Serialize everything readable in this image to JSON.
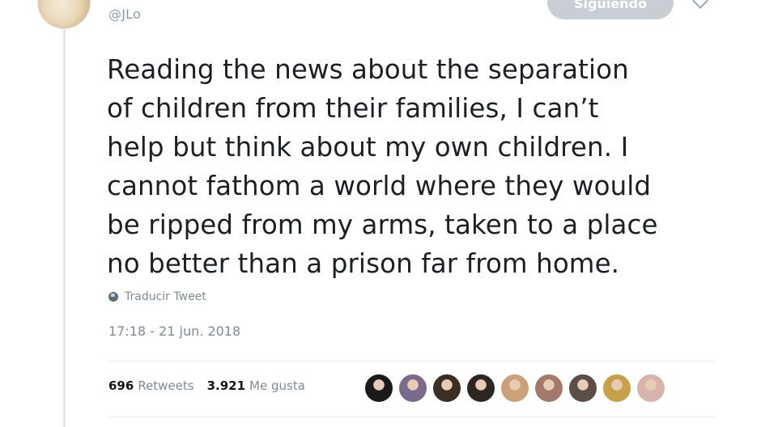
{
  "tweet": {
    "handle": "@JLo",
    "follow_label": "Siguiendo",
    "text": "Reading the news about the separation\nof children from their families, I can’t\nhelp but think about my own children. I\ncannot fathom a world where they would\nbe ripped from my arms, taken to a place\nno better than a prison far from home.",
    "translate_label": "Traducir Tweet",
    "timestamp": "17:18 - 21 jun. 2018",
    "retweets_count": "696",
    "retweets_label": "Retweets",
    "likes_count": "3.921",
    "likes_label": "Me gusta"
  },
  "likers": [
    {
      "color": "#1a1a1a",
      "icon": "avatar"
    },
    {
      "color": "#7a6a8c",
      "icon": "avatar"
    },
    {
      "color": "#3b2e25",
      "icon": "avatar"
    },
    {
      "color": "#2b2623",
      "icon": "avatar"
    },
    {
      "color": "#c9a27a",
      "icon": "avatar"
    },
    {
      "color": "#a4786a",
      "icon": "avatar"
    },
    {
      "color": "#5a4e46",
      "icon": "avatar"
    },
    {
      "color": "#c7a04a",
      "icon": "avatar"
    },
    {
      "color": "#d9b3ae",
      "icon": "avatar"
    }
  ],
  "colors": {
    "text": "#1c2024",
    "secondary": "#7e8b96",
    "follow_button": "#c8ced3"
  }
}
